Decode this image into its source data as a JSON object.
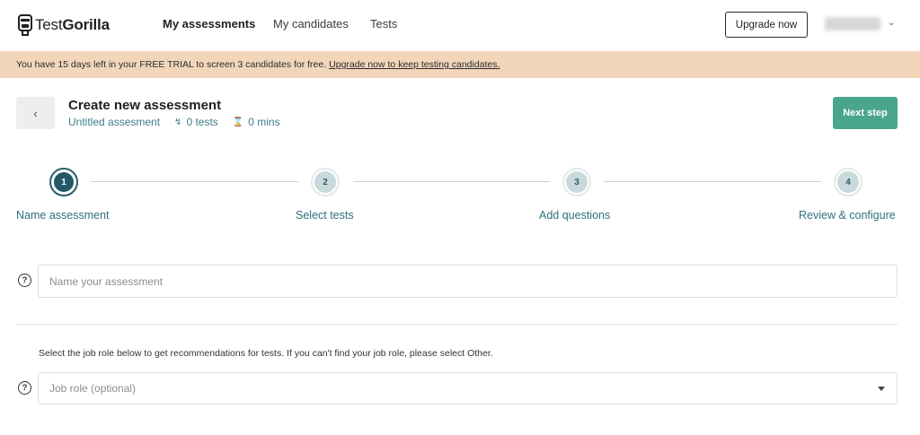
{
  "brand": {
    "name_light": "Test",
    "name_bold": "Gorilla",
    "accent": "#4aa58d",
    "teal": "#2f6f7f"
  },
  "nav": {
    "items": [
      {
        "label": "My assessments",
        "active": true
      },
      {
        "label": "My candidates",
        "active": false
      },
      {
        "label": "Tests",
        "active": false
      }
    ],
    "upgrade_label": "Upgrade now",
    "chevron_icon": "chevron-down-icon"
  },
  "banner": {
    "text": "You have 15 days left in your FREE TRIAL to screen 3 candidates for free.",
    "link": "Upgrade now to keep testing candidates.",
    "color": "#f2d6ba"
  },
  "assessment": {
    "back_icon": "chevron-left-icon",
    "title": "Create new assessment",
    "name": "Untitled assesment",
    "tests_count": "0 tests",
    "duration": "0 mins",
    "next_label": "Next step"
  },
  "stepper": {
    "steps": [
      {
        "number": "1",
        "label": "Name assessment",
        "state": "active"
      },
      {
        "number": "2",
        "label": "Select tests",
        "state": "todo"
      },
      {
        "number": "3",
        "label": "Add questions",
        "state": "todo"
      },
      {
        "number": "4",
        "label": "Review & configure",
        "state": "todo"
      }
    ]
  },
  "form": {
    "name_placeholder": "Name your assessment",
    "name_value": "",
    "job_hint": "Select the job role below to get recommendations for tests. If you can't find your job role, please select Other.",
    "job_placeholder": "Job role (optional)",
    "help_icon": "question-circle-icon"
  }
}
